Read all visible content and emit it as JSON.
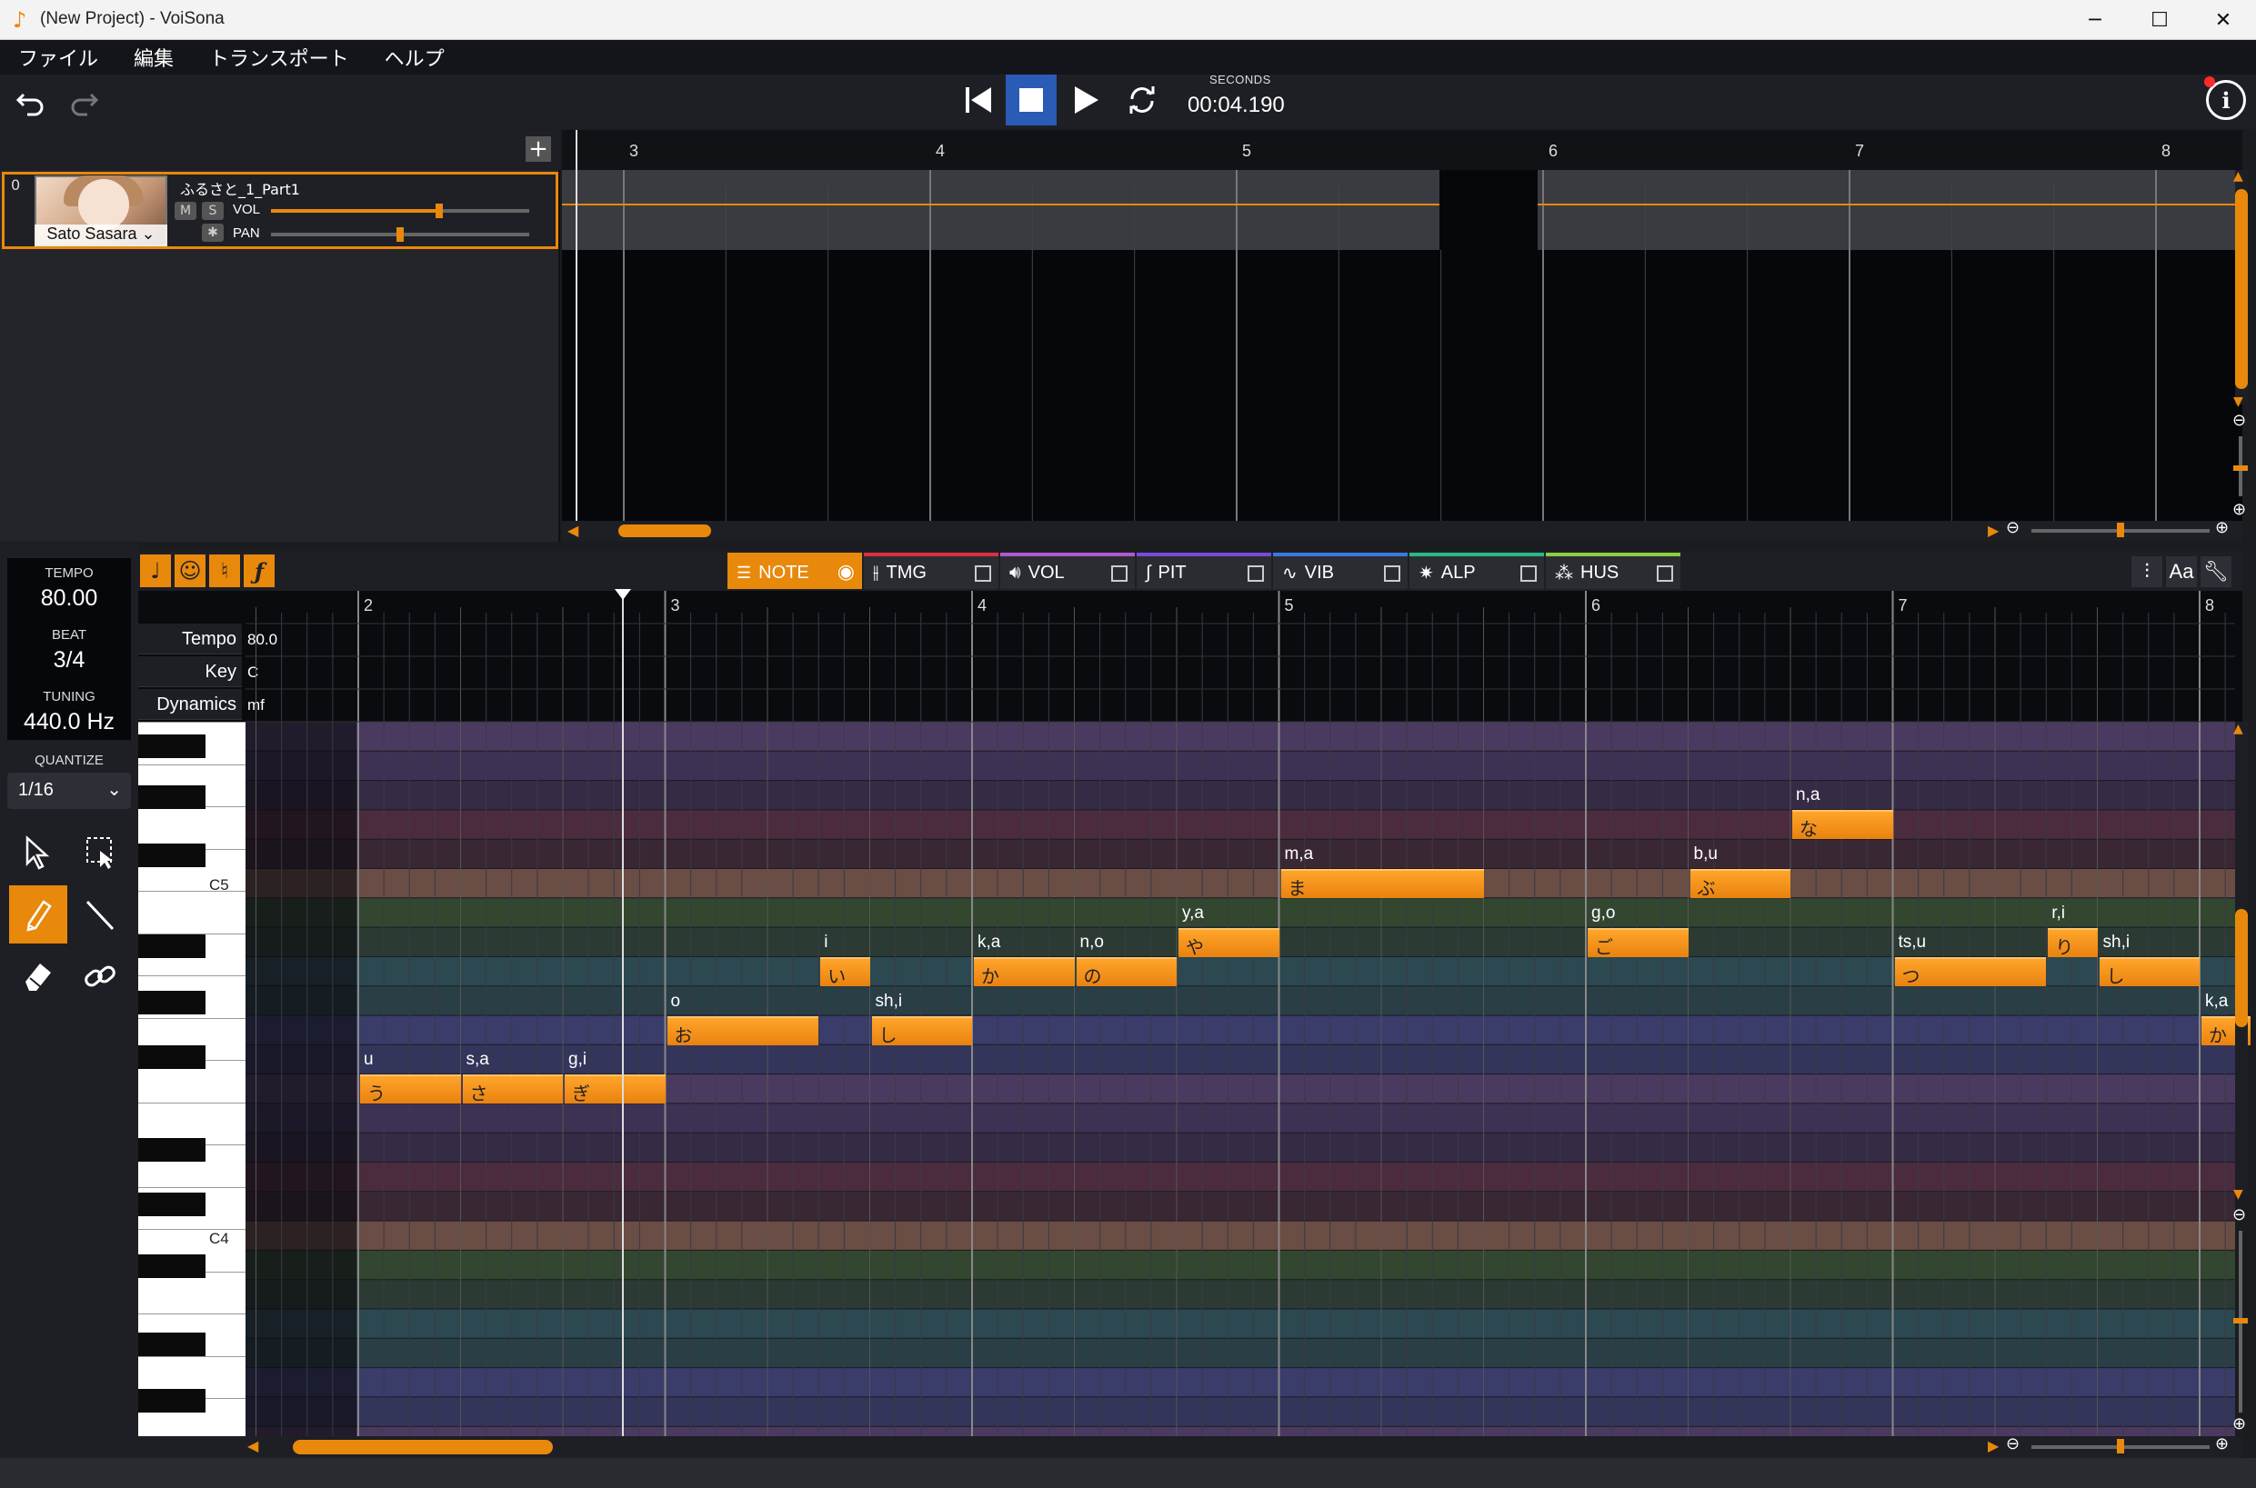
{
  "window": {
    "title": "(New Project) - VoiSona",
    "minimize_icon": "minimize-icon",
    "maximize_icon": "maximize-icon",
    "close_icon": "close-icon"
  },
  "menu": [
    "ファイル",
    "編集",
    "トランスポート",
    "ヘルプ"
  ],
  "transport": {
    "time_label": "SECONDS",
    "time_value": "00:04.190",
    "icons": [
      "undo-icon",
      "redo-icon",
      "skip-to-start-icon",
      "stop-icon",
      "play-icon",
      "loop-icon",
      "info-icon"
    ]
  },
  "track": {
    "index": "0",
    "singer": "Sato Sasara",
    "name": "ふるさと_1_Part1",
    "mute_label": "M",
    "solo_label": "S",
    "vol_label": "VOL",
    "pan_label": "PAN",
    "vol_level": 0.65,
    "pan_level": 0.5
  },
  "arrangement": {
    "bar_numbers": [
      "3",
      "4",
      "5",
      "6",
      "7",
      "8"
    ]
  },
  "song_info": {
    "tempo_label": "TEMPO",
    "tempo_value": "80.00",
    "beat_label": "BEAT",
    "beat_value": "3/4",
    "tuning_label": "TUNING",
    "tuning_value": "440.0 Hz",
    "quantize_label": "QUANTIZE",
    "quantize_value": "1/16"
  },
  "tools": [
    "select-arrow-icon",
    "box-select-icon",
    "pencil-icon",
    "line-icon",
    "eraser-icon",
    "link-icon"
  ],
  "editor_tabs": [
    {
      "label": "NOTE",
      "color": "#e8890c"
    },
    {
      "label": "TMG",
      "color": "#d8323c"
    },
    {
      "label": "VOL",
      "color": "#b05ad0"
    },
    {
      "label": "PIT",
      "color": "#7a4ae0"
    },
    {
      "label": "VIB",
      "color": "#3a7ae0"
    },
    {
      "label": "ALP",
      "color": "#2ab888"
    },
    {
      "label": "HUS",
      "color": "#8ad040"
    }
  ],
  "right_tools": {
    "aa_label": "Aa",
    "icons": [
      "mixer-icon",
      "font-icon",
      "wrench-icon"
    ]
  },
  "roll": {
    "bar_numbers": [
      "2",
      "3",
      "4",
      "5",
      "6",
      "7",
      "8"
    ],
    "tempo_label": "Tempo",
    "tempo_value": "80.0",
    "key_label": "Key",
    "key_value": "C",
    "dynamics_label": "Dynamics",
    "dynamics_value": "mf",
    "c5_label": "C5",
    "c4_label": "C4",
    "notes": [
      {
        "lyric": "う",
        "phoneme": "u"
      },
      {
        "lyric": "さ",
        "phoneme": "s,a"
      },
      {
        "lyric": "ぎ",
        "phoneme": "g,i"
      },
      {
        "lyric": "お",
        "phoneme": "o"
      },
      {
        "lyric": "い",
        "phoneme": "i"
      },
      {
        "lyric": "し",
        "phoneme": "sh,i"
      },
      {
        "lyric": "か",
        "phoneme": "k,a"
      },
      {
        "lyric": "の",
        "phoneme": "n,o"
      },
      {
        "lyric": "や",
        "phoneme": "y,a"
      },
      {
        "lyric": "ま",
        "phoneme": "m,a"
      },
      {
        "lyric": "ご",
        "phoneme": "g,o"
      },
      {
        "lyric": "ぶ",
        "phoneme": "b,u"
      },
      {
        "lyric": "な",
        "phoneme": "n,a"
      },
      {
        "lyric": "つ",
        "phoneme": "ts,u"
      },
      {
        "lyric": "り",
        "phoneme": "r,i"
      },
      {
        "lyric": "し",
        "phoneme": "sh,i"
      },
      {
        "lyric": "か",
        "phoneme": "k,a"
      }
    ]
  }
}
